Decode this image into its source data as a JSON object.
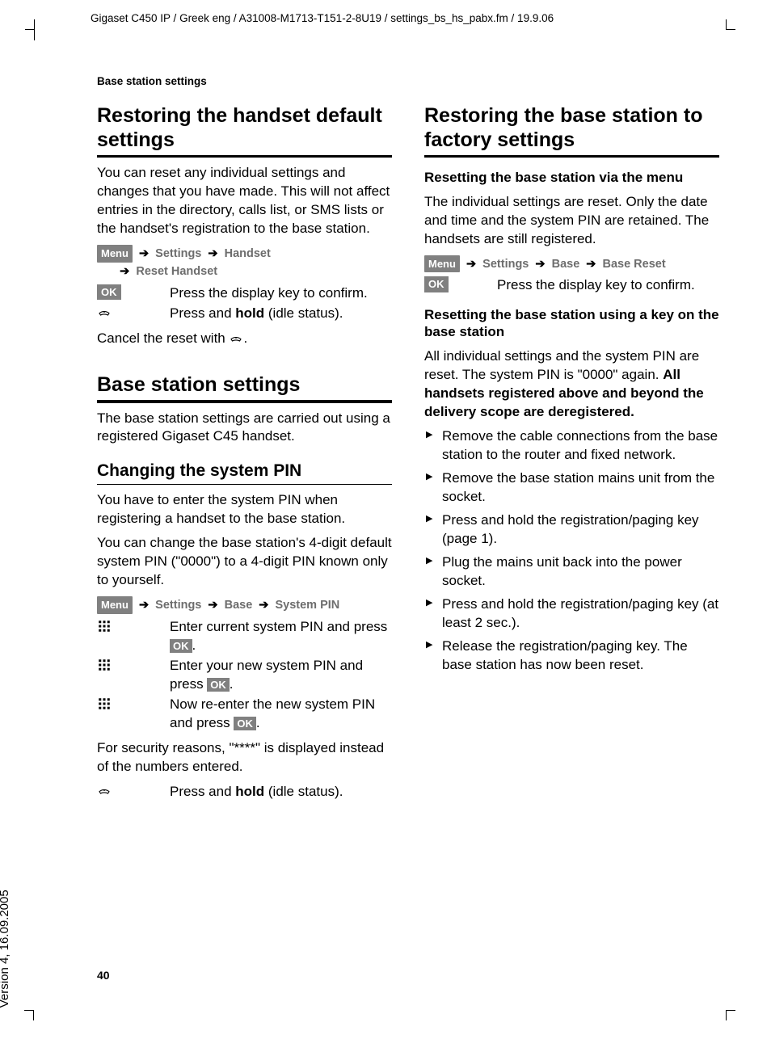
{
  "meta": {
    "header": "Gigaset C450 IP / Greek eng / A31008-M1713-T151-2-8U19 / settings_bs_hs_pabx.fm / 19.9.06",
    "version": "Version 4, 16.09.2005",
    "running_head": "Base station settings",
    "page_number": "40"
  },
  "keys": {
    "menu": "Menu",
    "ok": "OK"
  },
  "nav_labels": {
    "settings": "Settings",
    "handset": "Handset",
    "reset_handset": "Reset Handset",
    "base": "Base",
    "system_pin": "System PIN",
    "base_reset": "Base Reset"
  },
  "left": {
    "h1": "Restoring the handset default settings",
    "p1": "You can reset any individual settings and changes that you have made. This will not affect entries in the directory, calls list, or SMS lists or the handset's registration to the base station.",
    "step_ok": "Press the display key to confirm.",
    "step_hold_pre": "Press and ",
    "step_hold_bold": "hold",
    "step_hold_post": " (idle status).",
    "cancel_pre": "Cancel the reset with ",
    "cancel_post": ".",
    "h_base": "Base station settings",
    "p_base": "The base station settings are carried out using a registered Gigaset C45 handset.",
    "h_pin": "Changing the system PIN",
    "p_pin1": "You have to enter the system PIN when registering a handset to the base station.",
    "p_pin2": "You can change the base station's 4-digit default system PIN (\"0000\") to a 4-digit PIN known only to yourself.",
    "pin_step1_pre": "Enter current system PIN and press ",
    "pin_step2_pre": "Enter your new system PIN and press ",
    "pin_step3_pre": "Now re-enter the new system PIN and press ",
    "p_sec": "For security reasons, \"****\" is displayed instead of the numbers entered."
  },
  "right": {
    "h1": "Restoring the base station to factory settings",
    "h_menu": "Resetting the base station via the menu",
    "p_menu": "The individual settings are reset. Only the date and time and the system PIN are retained. The handsets are still registered.",
    "step_ok": "Press the display key to confirm.",
    "h_key": "Resetting the base station using a key on the base station",
    "p_key_pre": "All individual settings and the system PIN are reset. The system PIN is \"0000\" again. ",
    "p_key_bold": "All handsets registered above and beyond the delivery scope are deregistered.",
    "bullets": [
      "Remove the cable connections from the base station to the router and fixed network.",
      "Remove the base station mains unit from the socket.",
      "Press and hold the registration/paging key (page 1).",
      "Plug the mains unit back into the power socket.",
      "Press and hold the registration/paging key (at least 2 sec.).",
      "Release the registration/paging key. The base station has now been reset."
    ]
  }
}
